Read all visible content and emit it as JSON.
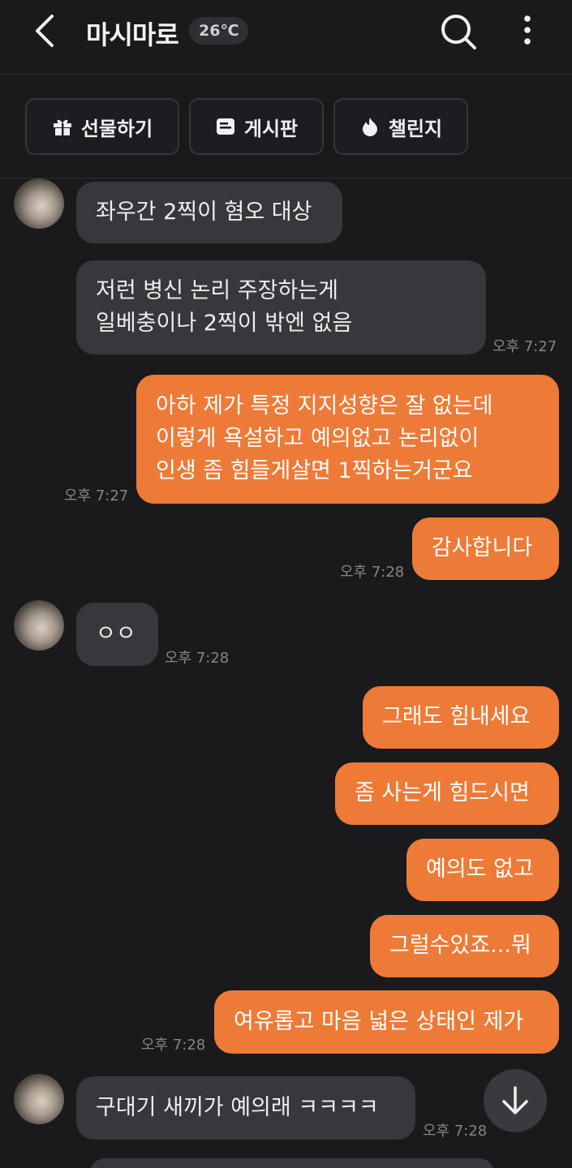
{
  "header": {
    "title": "마시마로",
    "temperature": "26℃",
    "icons": {
      "back": "back-arrow-icon",
      "search": "search-icon",
      "more": "more-vertical-icon"
    }
  },
  "actions": [
    {
      "label": "선물하기",
      "icon": "gift-icon"
    },
    {
      "label": "게시판",
      "icon": "board-icon"
    },
    {
      "label": "챌린지",
      "icon": "flame-icon"
    }
  ],
  "messages": [
    {
      "side": "in",
      "text": "좌우간 2찍이 혐오 대상"
    },
    {
      "side": "in",
      "text": "저런 병신 논리 주장하는게\n일베충이나 2찍이 밖엔 없음",
      "time": "오후 7:27"
    },
    {
      "side": "out",
      "text": "아하 제가 특정 지지성향은 잘 없는데\n이렇게 욕설하고 예의없고 논리없이\n인생 좀 힘들게살면 1찍하는거군요",
      "time": "오후 7:27"
    },
    {
      "side": "out",
      "text": "감사합니다",
      "time": "오후 7:28"
    },
    {
      "side": "in",
      "text": "ㅇㅇ",
      "time": "오후 7:28"
    },
    {
      "side": "out",
      "text": "그래도 힘내세요"
    },
    {
      "side": "out",
      "text": "좀 사는게 힘드시면"
    },
    {
      "side": "out",
      "text": "예의도 없고"
    },
    {
      "side": "out",
      "text": "그럴수있죠...뭐"
    },
    {
      "side": "out",
      "text": "여유롭고 마음 넓은 상태인 제가",
      "time": "오후 7:28"
    },
    {
      "side": "in",
      "text": "구대기 새끼가 예의래 ㅋㅋㅋㅋ",
      "time": "오후 7:28"
    }
  ],
  "colors": {
    "background": "#1a1a1d",
    "outgoing": "#ee7a37",
    "incoming": "#38383c"
  },
  "scroll_button_icon": "arrow-down-icon"
}
